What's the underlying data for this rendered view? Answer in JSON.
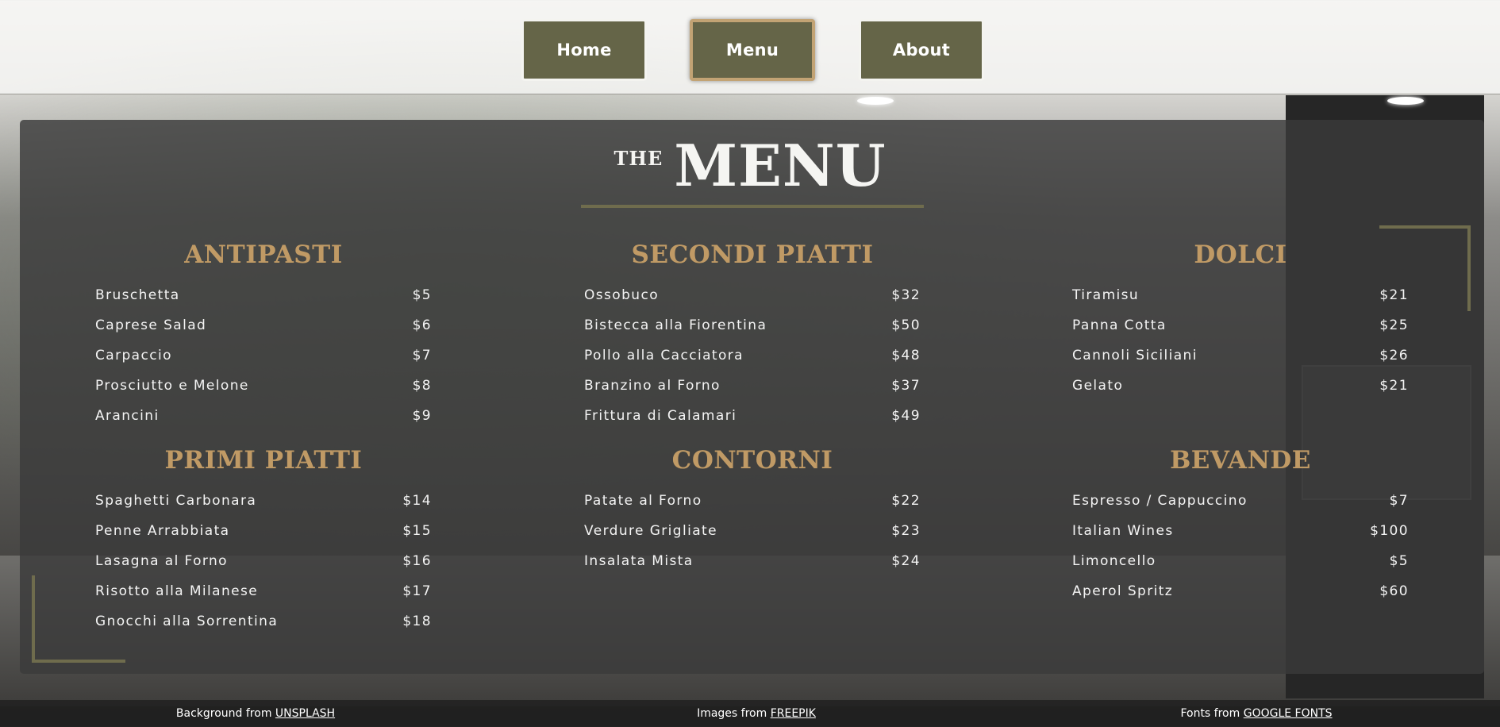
{
  "nav": {
    "home": "Home",
    "menu": "Menu",
    "about": "About"
  },
  "heading": {
    "the": "THE",
    "menu": "MENU"
  },
  "sections": {
    "antipasti": {
      "title": "ANTIPASTI",
      "items": [
        {
          "name": "Bruschetta",
          "price": "$5"
        },
        {
          "name": "Caprese Salad",
          "price": "$6"
        },
        {
          "name": "Carpaccio",
          "price": "$7"
        },
        {
          "name": "Prosciutto e Melone",
          "price": "$8"
        },
        {
          "name": "Arancini",
          "price": "$9"
        }
      ]
    },
    "secondi": {
      "title": "SECONDI PIATTI",
      "items": [
        {
          "name": "Ossobuco",
          "price": "$32"
        },
        {
          "name": "Bistecca alla Fiorentina",
          "price": "$50"
        },
        {
          "name": "Pollo alla Cacciatora",
          "price": "$48"
        },
        {
          "name": "Branzino al Forno",
          "price": "$37"
        },
        {
          "name": "Frittura di Calamari",
          "price": "$49"
        }
      ]
    },
    "dolci": {
      "title": "DOLCI",
      "items": [
        {
          "name": "Tiramisu",
          "price": "$21"
        },
        {
          "name": "Panna Cotta",
          "price": "$25"
        },
        {
          "name": "Cannoli Siciliani",
          "price": "$26"
        },
        {
          "name": "Gelato",
          "price": "$21"
        }
      ]
    },
    "primi": {
      "title": "PRIMI PIATTI",
      "items": [
        {
          "name": "Spaghetti Carbonara",
          "price": "$14"
        },
        {
          "name": "Penne Arrabbiata",
          "price": "$15"
        },
        {
          "name": "Lasagna al Forno",
          "price": "$16"
        },
        {
          "name": "Risotto alla Milanese",
          "price": "$17"
        },
        {
          "name": "Gnocchi alla Sorrentina",
          "price": "$18"
        }
      ]
    },
    "contorni": {
      "title": "CONTORNI",
      "items": [
        {
          "name": "Patate al Forno",
          "price": "$22"
        },
        {
          "name": "Verdure Grigliate",
          "price": "$23"
        },
        {
          "name": "Insalata Mista",
          "price": "$24"
        }
      ]
    },
    "bevande": {
      "title": "BEVANDE",
      "items": [
        {
          "name": "Espresso / Cappuccino",
          "price": "$7"
        },
        {
          "name": "Italian Wines",
          "price": "$100"
        },
        {
          "name": "Limoncello",
          "price": "$5"
        },
        {
          "name": "Aperol Spritz",
          "price": "$60"
        }
      ]
    }
  },
  "footer": {
    "bg_prefix": "Background from ",
    "bg_link": "UNSPLASH",
    "img_prefix": "Images from ",
    "img_link": "FREEPIK",
    "font_prefix": "Fonts from ",
    "font_link": "GOOGLE FONTS"
  },
  "colors": {
    "nav_button": "#656548",
    "accent_gold": "#c09a65",
    "olive_rule": "#6f6c4d"
  }
}
